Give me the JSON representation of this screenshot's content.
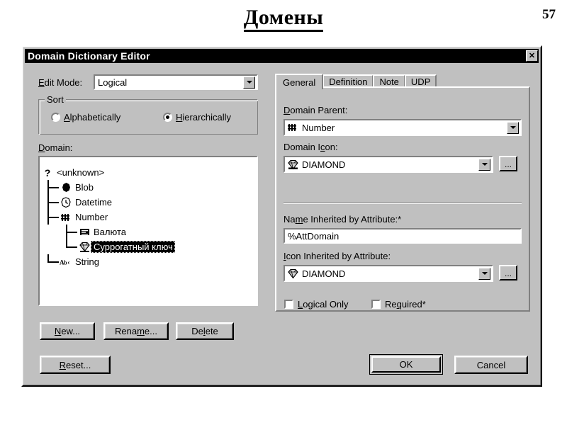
{
  "slide": {
    "title": "Домены",
    "number": "57"
  },
  "dialog": {
    "title": "Domain Dictionary Editor",
    "close_label": "✕"
  },
  "left_panel": {
    "edit_mode_label": "Edit Mode:",
    "edit_mode_accesskey": "E",
    "edit_mode_value": "Logical",
    "sort_group_label": "Sort",
    "sort_options": [
      {
        "label": "Alphabetically",
        "accesskey": "A",
        "selected": false
      },
      {
        "label": "Hierarchically",
        "accesskey": "H",
        "selected": true
      }
    ],
    "domain_label": "Domain:",
    "domain_accesskey": "D",
    "tree": [
      {
        "label": "<unknown>",
        "icon": "question-mark-icon",
        "depth": 0,
        "selected": false
      },
      {
        "label": "Blob",
        "icon": "blob-icon",
        "depth": 1,
        "selected": false
      },
      {
        "label": "Datetime",
        "icon": "clock-icon",
        "depth": 1,
        "selected": false
      },
      {
        "label": "Number",
        "icon": "number-hash-icon",
        "depth": 1,
        "selected": false
      },
      {
        "label": "Валюта",
        "icon": "currency-icon",
        "depth": 2,
        "selected": false
      },
      {
        "label": "Суррогатный ключ",
        "icon": "diamond-icon",
        "depth": 2,
        "selected": true
      },
      {
        "label": "String",
        "icon": "abc-icon",
        "depth": 1,
        "selected": false
      }
    ],
    "buttons": [
      {
        "label": "New...",
        "accesskey": "N",
        "name": "new-button"
      },
      {
        "label": "Rename...",
        "accesskey": "m",
        "name": "rename-button"
      },
      {
        "label": "Delete",
        "accesskey": "l",
        "name": "delete-button"
      }
    ],
    "reset_label": "Reset...",
    "reset_accesskey": "R"
  },
  "tabs": [
    {
      "label": "General",
      "active": true
    },
    {
      "label": "Definition",
      "active": false
    },
    {
      "label": "Note",
      "active": false
    },
    {
      "label": "UDP",
      "active": false
    }
  ],
  "general_tab": {
    "domain_parent_label": "Domain Parent:",
    "domain_parent_accesskey": "D",
    "domain_parent_value": "Number",
    "domain_parent_icon": "number-hash-icon",
    "domain_icon_label": "Domain Icon:",
    "domain_icon_accesskey": "c",
    "domain_icon_value": "DIAMOND",
    "domain_icon_glyph": "diamond-icon",
    "domain_icon_browse_label": "...",
    "name_inherited_label": "Name Inherited by Attribute:*",
    "name_inherited_accesskey": "m",
    "name_inherited_value": "%AttDomain",
    "icon_inherited_label": "Icon Inherited by Attribute:",
    "icon_inherited_accesskey": "I",
    "icon_inherited_value": "DIAMOND",
    "icon_inherited_glyph": "diamond-icon",
    "icon_inherited_browse_label": "...",
    "checkboxes": [
      {
        "label": "Logical Only",
        "accesskey": "L",
        "checked": false
      },
      {
        "label": "Required*",
        "accesskey": "q",
        "checked": false
      }
    ]
  },
  "footer": {
    "ok_label": "OK",
    "cancel_label": "Cancel"
  },
  "colors": {
    "dialog_face": "#c0c0c0",
    "titlebar": "#000000",
    "field_bg": "#ffffff",
    "shadow": "#808080",
    "highlight": "#ffffff"
  }
}
